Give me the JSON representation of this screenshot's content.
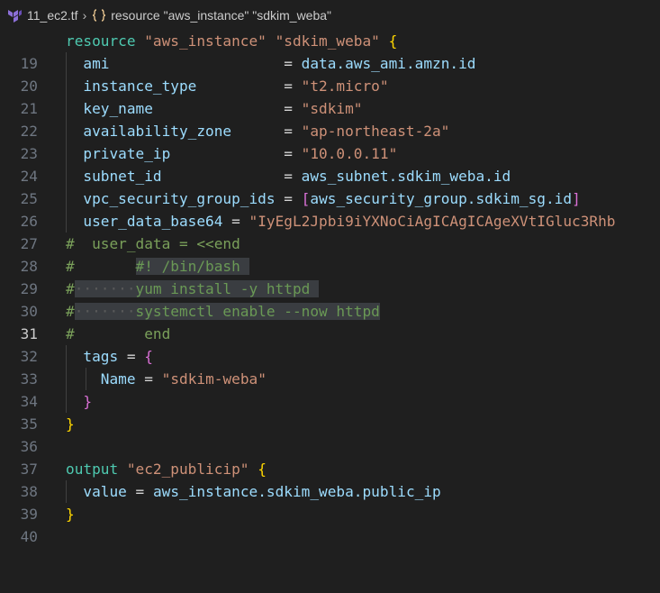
{
  "breadcrumb": {
    "file_name": "11_ec2.tf",
    "symbol": "resource \"aws_instance\" \"sdkim_weba\""
  },
  "editor": {
    "lines": [
      {
        "n": "19"
      },
      {
        "n": "20"
      },
      {
        "n": "21"
      },
      {
        "n": "22"
      },
      {
        "n": "23"
      },
      {
        "n": "24"
      },
      {
        "n": "25"
      },
      {
        "n": "26"
      },
      {
        "n": "27"
      },
      {
        "n": "28"
      },
      {
        "n": "29"
      },
      {
        "n": "30"
      },
      {
        "n": "31"
      },
      {
        "n": "32"
      },
      {
        "n": "33"
      },
      {
        "n": "34"
      },
      {
        "n": "35"
      },
      {
        "n": "36"
      },
      {
        "n": "37"
      },
      {
        "n": "38"
      },
      {
        "n": "39"
      },
      {
        "n": "40"
      }
    ],
    "active_line": "31",
    "t": {
      "resource": "resource",
      "res_type": "\"aws_instance\"",
      "res_name": "\"sdkim_weba\"",
      "ami_key": "ami",
      "ami_val": "data.aws_ami.amzn.id",
      "itype_key": "instance_type",
      "itype_val": "\"t2.micro\"",
      "key_key": "key_name",
      "key_val": "\"sdkim\"",
      "az_key": "availability_zone",
      "az_val": "\"ap-northeast-2a\"",
      "pip_key": "private_ip",
      "pip_val": "\"10.0.0.11\"",
      "subnet_key": "subnet_id",
      "subnet_val": "aws_subnet.sdkim_weba.id",
      "vpc_key": "vpc_security_group_ids",
      "vpc_val": "aws_security_group.sdkim_sg.id",
      "ud_key": "user_data_base64",
      "ud_val": "\"IyEgL2Jpbi9iYXNoCiAgICAgICAgeXVtIGluc3Rhb",
      "c28": "#  user_data = <<end",
      "c29_hash": "#",
      "c29_sel": "#! /bin/bash",
      "c30_hash": "#",
      "c30_sel": "yum install -y httpd",
      "c31_hash": "#",
      "c31_sel": "systemctl enable --now httpd",
      "c32": "#        end",
      "tags_key": "tags",
      "name_key": "Name",
      "name_val": "\"sdkim-weba\"",
      "output": "output",
      "out_name": "\"ec2_publicip\"",
      "value_key": "value",
      "value_val": "aws_instance.sdkim_weba.public_ip"
    }
  },
  "colors": {
    "background": "#1f1f1f",
    "keyword": "#4ec9b0",
    "string": "#ce9178",
    "attribute": "#9cdcfe",
    "comment": "#6a9955",
    "bracket_level1": "#ffd700",
    "bracket_level2": "#da70d6",
    "selection": "#3a3d41"
  },
  "icons": {
    "file_icon": "terraform-icon",
    "symbol_icon": "symbol-braces-icon",
    "separator_icon": "chevron-right-icon"
  }
}
